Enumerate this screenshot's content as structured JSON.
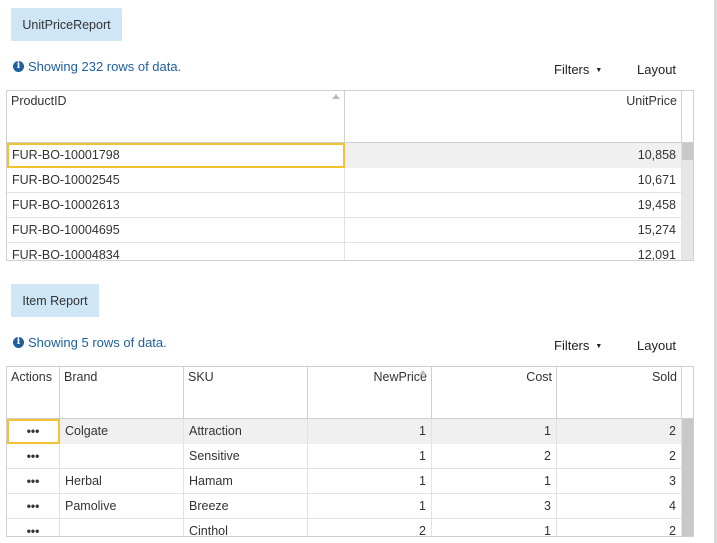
{
  "report1": {
    "tab_label": "UnitPriceReport",
    "info_text": "Showing 232 rows of data.",
    "filters_label": "Filters",
    "layout_label": "Layout",
    "columns": [
      "ProductID",
      "UnitPrice"
    ],
    "rows": [
      [
        "FUR-BO-10001798",
        "10,858"
      ],
      [
        "FUR-BO-10002545",
        "10,671"
      ],
      [
        "FUR-BO-10002613",
        "19,458"
      ],
      [
        "FUR-BO-10004695",
        "15,274"
      ],
      [
        "FUR-BO-10004834",
        "12,091"
      ]
    ]
  },
  "report2": {
    "tab_label": "Item Report",
    "info_text": "Showing 5 rows of data.",
    "filters_label": "Filters",
    "layout_label": "Layout",
    "columns": [
      "Actions",
      "Brand",
      "SKU",
      "NewPrice",
      "Cost",
      "Sold"
    ],
    "action_glyph": "•••",
    "rows": [
      [
        "Colgate",
        "Attraction",
        "1",
        "1",
        "2"
      ],
      [
        "",
        "Sensitive",
        "1",
        "2",
        "2"
      ],
      [
        "Herbal",
        "Hamam",
        "1",
        "1",
        "3"
      ],
      [
        "Pamolive",
        "Breeze",
        "1",
        "3",
        "4"
      ],
      [
        "",
        "Cinthol",
        "2",
        "1",
        "2"
      ]
    ]
  },
  "icons": {
    "info": "info-circle-icon",
    "caret": "caret-down-icon",
    "sort": "sort-arrow-icon",
    "actions": "more-dots-icon"
  }
}
